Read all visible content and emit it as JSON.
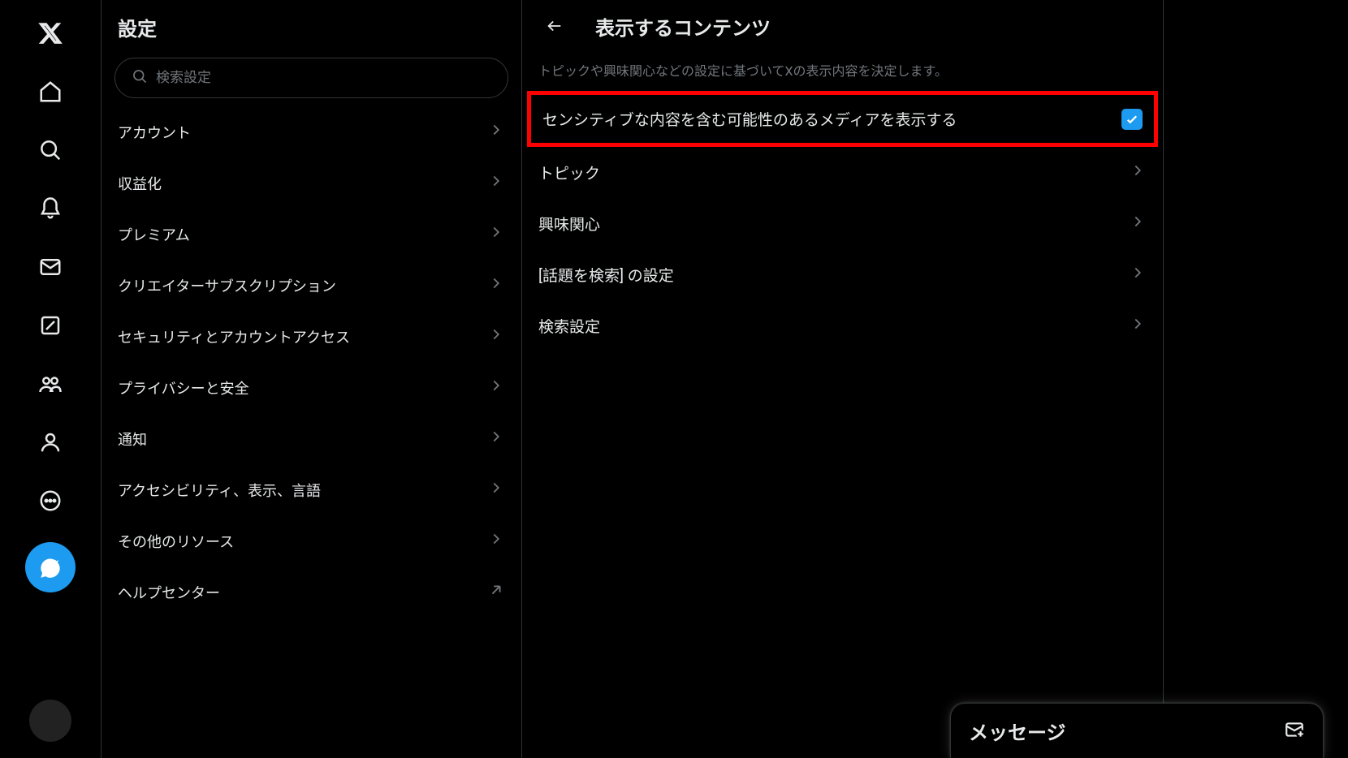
{
  "settings": {
    "title": "設定",
    "search_placeholder": "検索設定",
    "items": [
      {
        "label": "アカウント",
        "type": "link"
      },
      {
        "label": "収益化",
        "type": "link"
      },
      {
        "label": "プレミアム",
        "type": "link"
      },
      {
        "label": "クリエイターサブスクリプション",
        "type": "link"
      },
      {
        "label": "セキュリティとアカウントアクセス",
        "type": "link"
      },
      {
        "label": "プライバシーと安全",
        "type": "link"
      },
      {
        "label": "通知",
        "type": "link"
      },
      {
        "label": "アクセシビリティ、表示、言語",
        "type": "link"
      },
      {
        "label": "その他のリソース",
        "type": "link"
      },
      {
        "label": "ヘルプセンター",
        "type": "external"
      }
    ]
  },
  "detail": {
    "title": "表示するコンテンツ",
    "description": "トピックや興味関心などの設定に基づいてXの表示内容を決定します。",
    "sensitive_label": "センシティブな内容を含む可能性のあるメディアを表示する",
    "sensitive_checked": true,
    "items": [
      {
        "label": "トピック"
      },
      {
        "label": "興味関心"
      },
      {
        "label": "[話題を検索] の設定"
      },
      {
        "label": "検索設定"
      }
    ]
  },
  "messages": {
    "title": "メッセージ"
  }
}
